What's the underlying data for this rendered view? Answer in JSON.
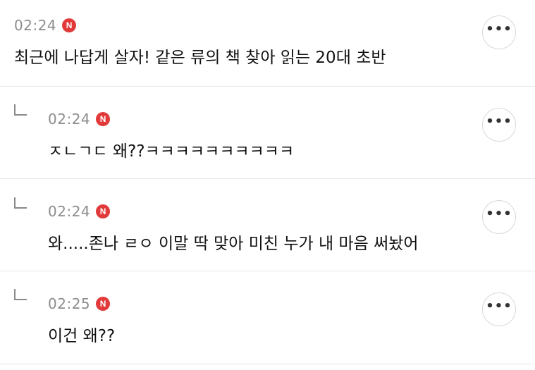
{
  "comments": [
    {
      "time": "02:24",
      "badge": "N",
      "text": "최근에 나답게 살자! 같은 류의 책 찾아 읽는 20대 초반",
      "is_reply": false
    },
    {
      "time": "02:24",
      "badge": "N",
      "text": "ㅈㄴㄱㄷ 왜??ㅋㅋㅋㅋㅋㅋㅋㅋㅋㅋ",
      "is_reply": true
    },
    {
      "time": "02:24",
      "badge": "N",
      "text": "와.....존나 ㄹㅇ 이말 딱 맞아 미친 누가 내 마음 써놨어",
      "is_reply": true
    },
    {
      "time": "02:25",
      "badge": "N",
      "text": "이건 왜??",
      "is_reply": true
    }
  ],
  "more_button_label": "•••",
  "icons": {
    "more": "more-horizontal-icon",
    "reply": "reply-arrow-icon",
    "new_badge": "new-badge-icon"
  },
  "colors": {
    "badge": "#e23a3a",
    "meta": "#8c8c8c",
    "divider": "#e6e6e6"
  }
}
